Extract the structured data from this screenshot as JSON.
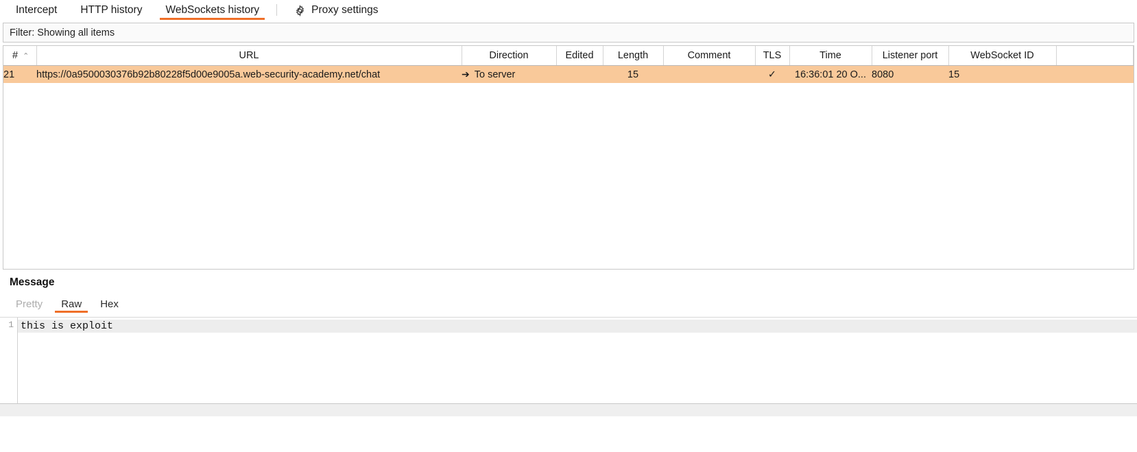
{
  "toolbar": {
    "tabs": [
      {
        "label": "Intercept",
        "selected": false
      },
      {
        "label": "HTTP history",
        "selected": false
      },
      {
        "label": "WebSockets history",
        "selected": true
      }
    ],
    "settings_label": "Proxy settings",
    "gear_icon": "gear-icon",
    "accent_color": "#ef6f28"
  },
  "filter": {
    "text": "Filter: Showing all items"
  },
  "table": {
    "columns": [
      "#",
      "URL",
      "Direction",
      "Edited",
      "Length",
      "Comment",
      "TLS",
      "Time",
      "Listener port",
      "WebSocket ID"
    ],
    "sort": {
      "column": "#",
      "caret": "⌃"
    },
    "rows": [
      {
        "num": "21",
        "url": "https://0a9500030376b92b80228f5d00e9005a.web-security-academy.net/chat",
        "direction_icon": "➔",
        "direction": "To server",
        "edited": "",
        "length": "15",
        "comment": "",
        "tls": "✓",
        "time": "16:36:01 20 O...",
        "listener_port": "8080",
        "websocket_id": "15",
        "selected": true,
        "highlight_color": "#f9c99a"
      }
    ]
  },
  "message": {
    "title": "Message",
    "tabs": [
      {
        "label": "Pretty",
        "state": "disabled"
      },
      {
        "label": "Raw",
        "state": "selected"
      },
      {
        "label": "Hex",
        "state": "normal"
      }
    ],
    "line_number": "1",
    "content": "this is exploit"
  }
}
